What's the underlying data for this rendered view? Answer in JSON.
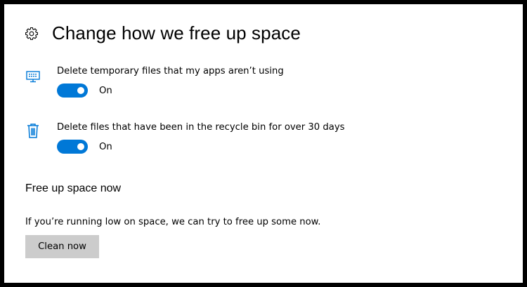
{
  "page": {
    "title": "Change how we free up space"
  },
  "settings": [
    {
      "icon": "temp-files-icon",
      "description": "Delete temporary files that my apps aren’t using",
      "toggle_on": true,
      "state_label": "On"
    },
    {
      "icon": "recycle-bin-icon",
      "description": "Delete files that have been in the recycle bin for over 30 days",
      "toggle_on": true,
      "state_label": "On"
    }
  ],
  "free_up_now": {
    "heading": "Free up space now",
    "description": "If you’re running low on space, we can try to free up some now.",
    "button_label": "Clean now"
  },
  "colors": {
    "accent": "#0078d7",
    "button_bg": "#cccccc",
    "icon": "#0078d7"
  }
}
